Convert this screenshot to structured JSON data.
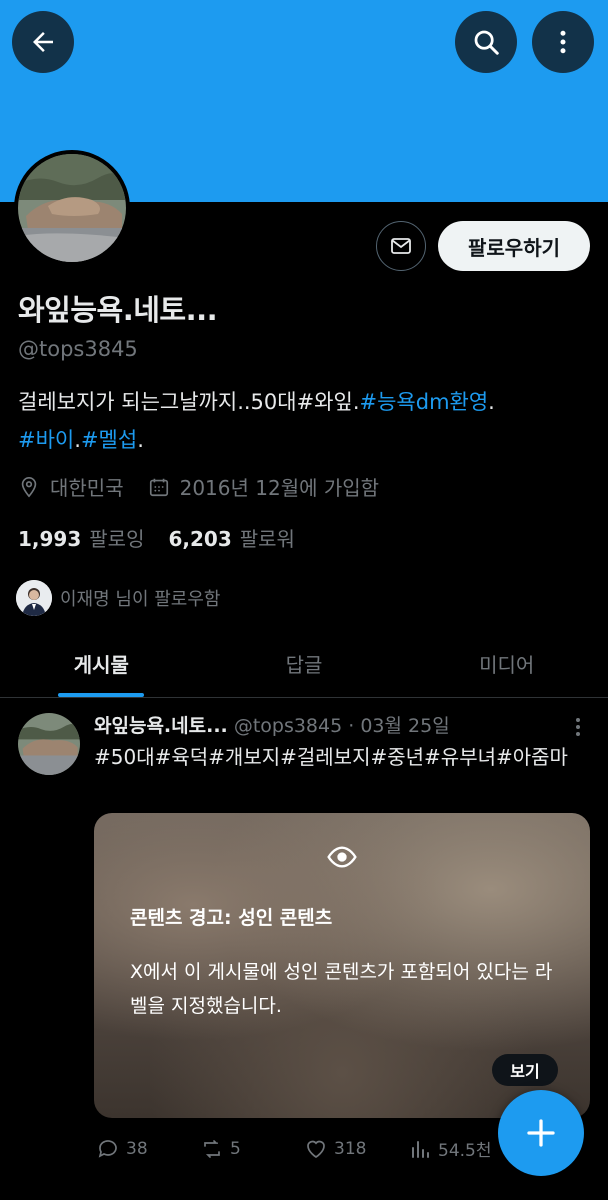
{
  "header": {
    "back_icon": "arrow-left-icon",
    "search_icon": "search-icon",
    "more_icon": "more-vertical-icon",
    "banner_color": "#1d9bf0"
  },
  "profile": {
    "display_name": "와잎능욕.네토...",
    "handle": "@tops3845",
    "follow_label": "팔로우하기",
    "bio_text_1": "걸레보지가 되는그날까지..50대#와잎.",
    "bio_link_1": "#능욕dm환영",
    "bio_dot_1": ".",
    "bio_link_2": "#바이",
    "bio_dot_2": ".",
    "bio_link_3": "#멜섭",
    "bio_dot_3": ".",
    "location": "대한민국",
    "joined": "2016년 12월에 가입함",
    "following_count": "1,993",
    "following_label": "팔로잉",
    "followers_count": "6,203",
    "followers_label": "팔로워",
    "followed_by_text": "이재명 님이 팔로우함"
  },
  "tabs": [
    {
      "label": "게시물",
      "active": true
    },
    {
      "label": "답글",
      "active": false
    },
    {
      "label": "미디어",
      "active": false
    }
  ],
  "post": {
    "name": "와잎능욕.네토...",
    "handle_date": "@tops3845 · 03월 25일",
    "text": "#50대#육덕#개보지#걸레보지#중년#유부녀#아줌마",
    "warning_title": "콘텐츠 경고: 성인 콘텐츠",
    "warning_desc": "X에서 이 게시물에 성인 콘텐츠가 포함되어 있다는 라벨을 지정했습니다.",
    "show_label": "보기",
    "replies": "38",
    "reposts": "5",
    "likes": "318",
    "views": "54.5천"
  },
  "fab": {
    "icon": "plus-icon"
  }
}
